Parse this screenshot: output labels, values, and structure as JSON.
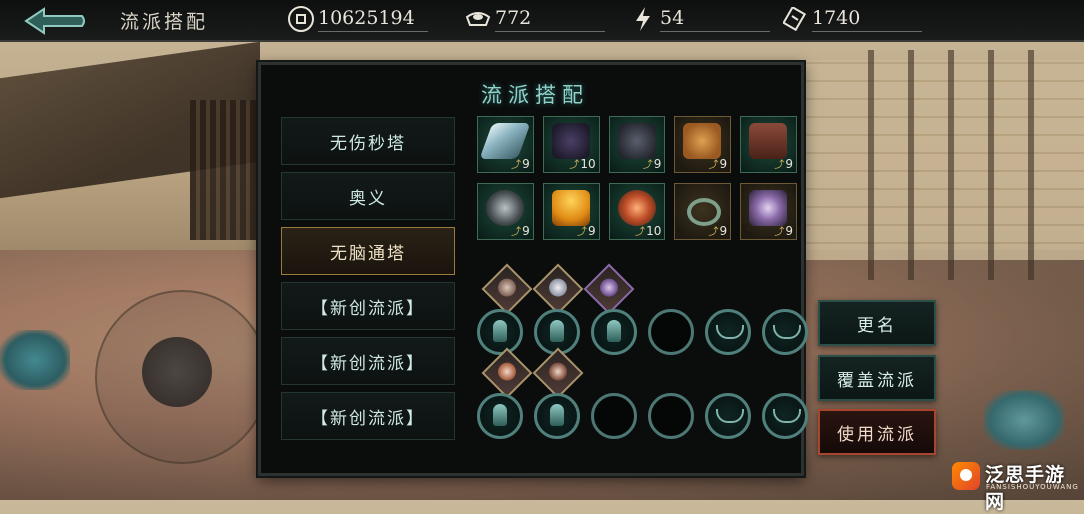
{
  "topbar": {
    "title": "流派搭配",
    "coins": "10625194",
    "ingots": "772",
    "energy": "54",
    "tickets": "1740"
  },
  "panel": {
    "title": "流派搭配",
    "builds": [
      {
        "label": "无伤秒塔",
        "selected": false
      },
      {
        "label": "奥义",
        "selected": false
      },
      {
        "label": "无脑通塔",
        "selected": true
      },
      {
        "label": "【新创流派】",
        "selected": false
      },
      {
        "label": "【新创流派】",
        "selected": false
      },
      {
        "label": "【新创流派】",
        "selected": false
      }
    ],
    "equipment_row1": [
      {
        "name": "crystal-blade",
        "level": "9"
      },
      {
        "name": "dark-wings",
        "level": "10"
      },
      {
        "name": "shadow-armor",
        "level": "9"
      },
      {
        "name": "tiger-helm",
        "level": "9"
      },
      {
        "name": "leather-boots",
        "level": "9"
      }
    ],
    "equipment_row2": [
      {
        "name": "orb-relic",
        "level": "9"
      },
      {
        "name": "golden-cape",
        "level": "9"
      },
      {
        "name": "flame-amulet",
        "level": "10"
      },
      {
        "name": "jade-bracelet",
        "level": "9"
      },
      {
        "name": "violet-claw",
        "level": "9"
      }
    ]
  },
  "side_buttons": {
    "rename": "更名",
    "overwrite": "覆盖流派",
    "use": "使用流派"
  },
  "watermark": {
    "text": "泛思手游网",
    "sub": "FANSISHOUYOUWANG"
  },
  "colors": {
    "panel_bg": "#0b0d0d",
    "title_teal": "#8fd2c9",
    "selected_gold": "#9c7a3d",
    "use_red": "#a9452e"
  }
}
